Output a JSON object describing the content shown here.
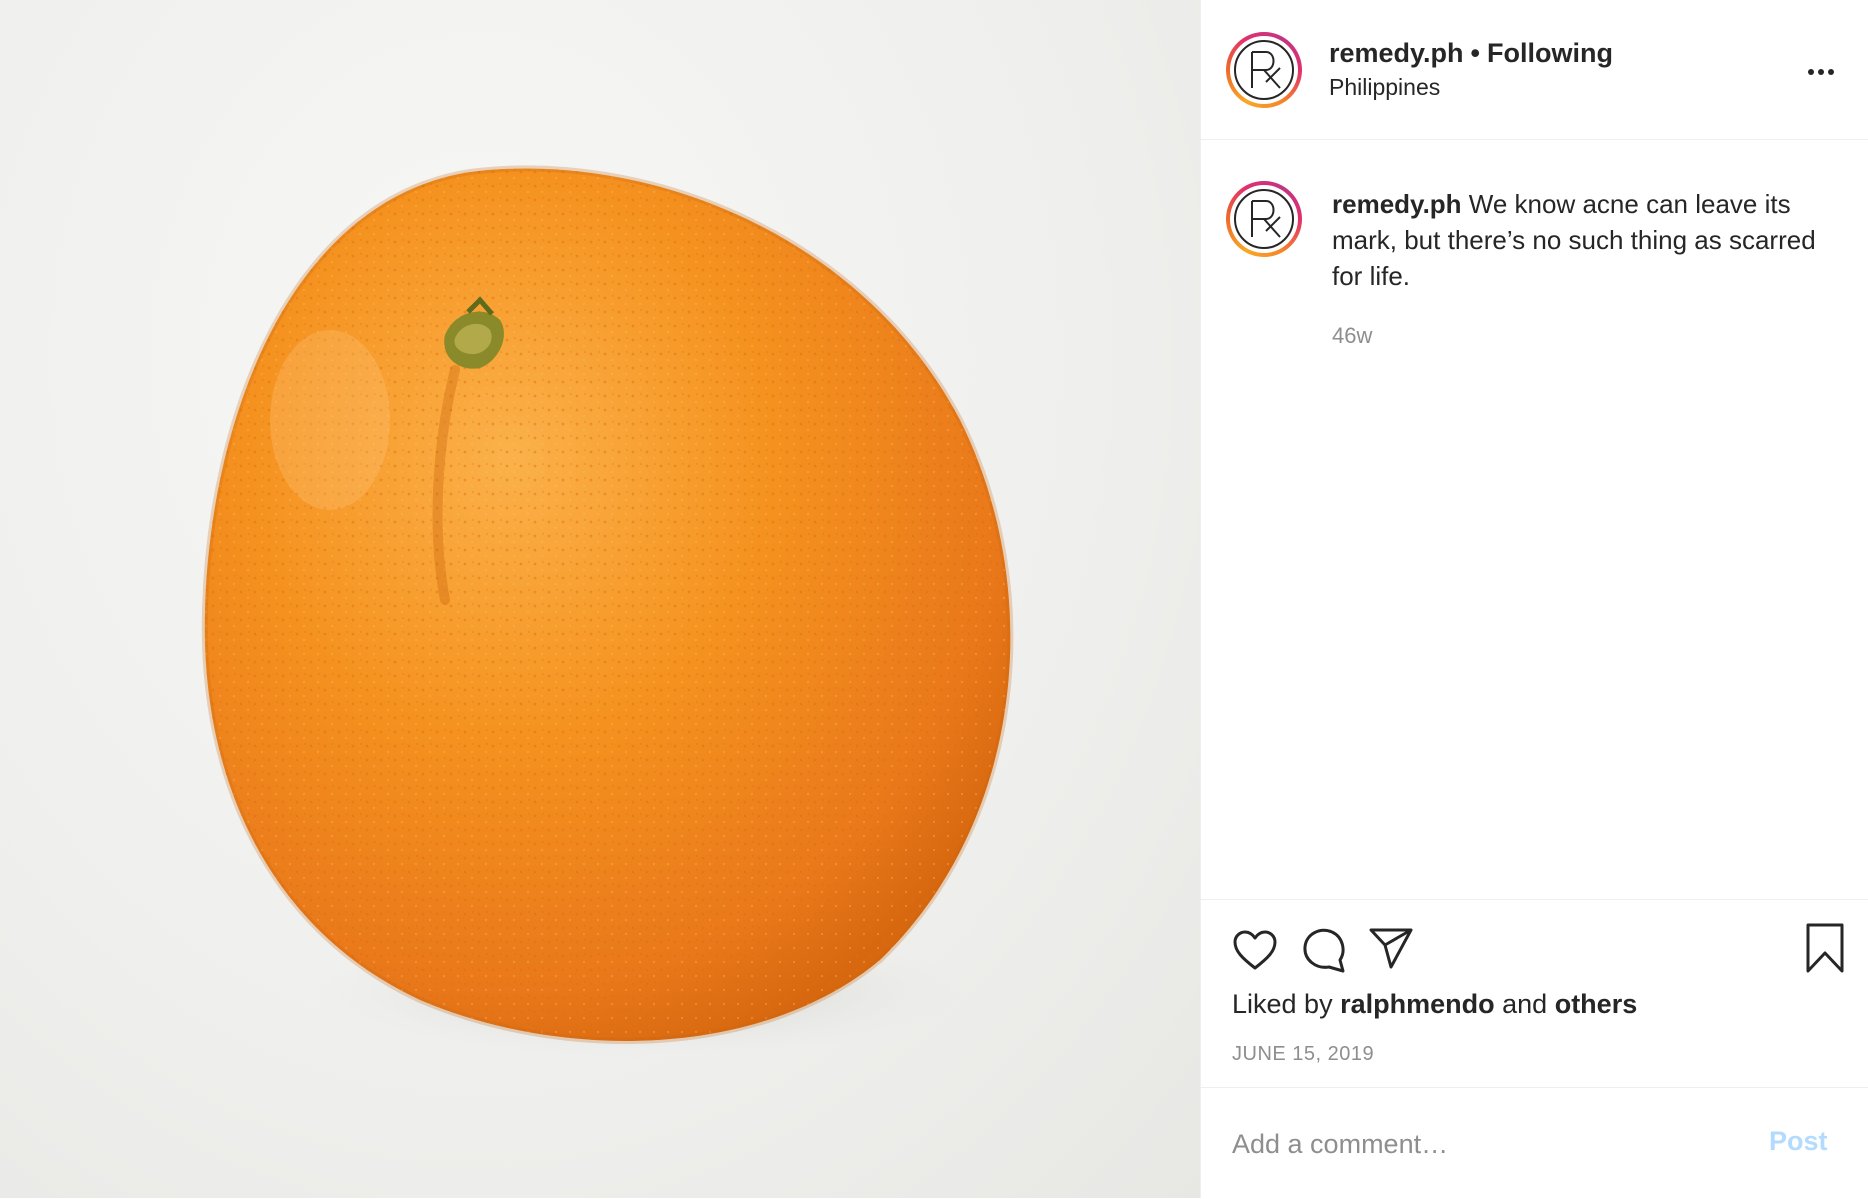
{
  "post": {
    "image_subject": "orange-fruit-photo",
    "header": {
      "username": "remedy.ph",
      "separator": "•",
      "follow_status": "Following",
      "location": "Philippines",
      "avatar_icon": "rx-logo-icon",
      "more_icon": "more-options-icon"
    },
    "caption": {
      "username": "remedy.ph",
      "text": "We know acne can leave its mark, but there’s no such thing as scarred for life.",
      "age": "46w"
    },
    "actions": {
      "like_icon": "heart-icon",
      "comment_icon": "comment-bubble-icon",
      "share_icon": "paper-plane-icon",
      "save_icon": "bookmark-icon"
    },
    "likes": {
      "prefix": "Liked by",
      "user": "ralphmendo",
      "connector": "and",
      "others": "others"
    },
    "date": "JUNE 15, 2019",
    "comment": {
      "placeholder": "Add a comment…",
      "post_label": "Post"
    },
    "colors": {
      "text": "#262626",
      "secondary_text": "#8e8e8e",
      "post_button_disabled": "#b3dbff",
      "border": "#efefef",
      "orange": "#f28a1e"
    }
  }
}
